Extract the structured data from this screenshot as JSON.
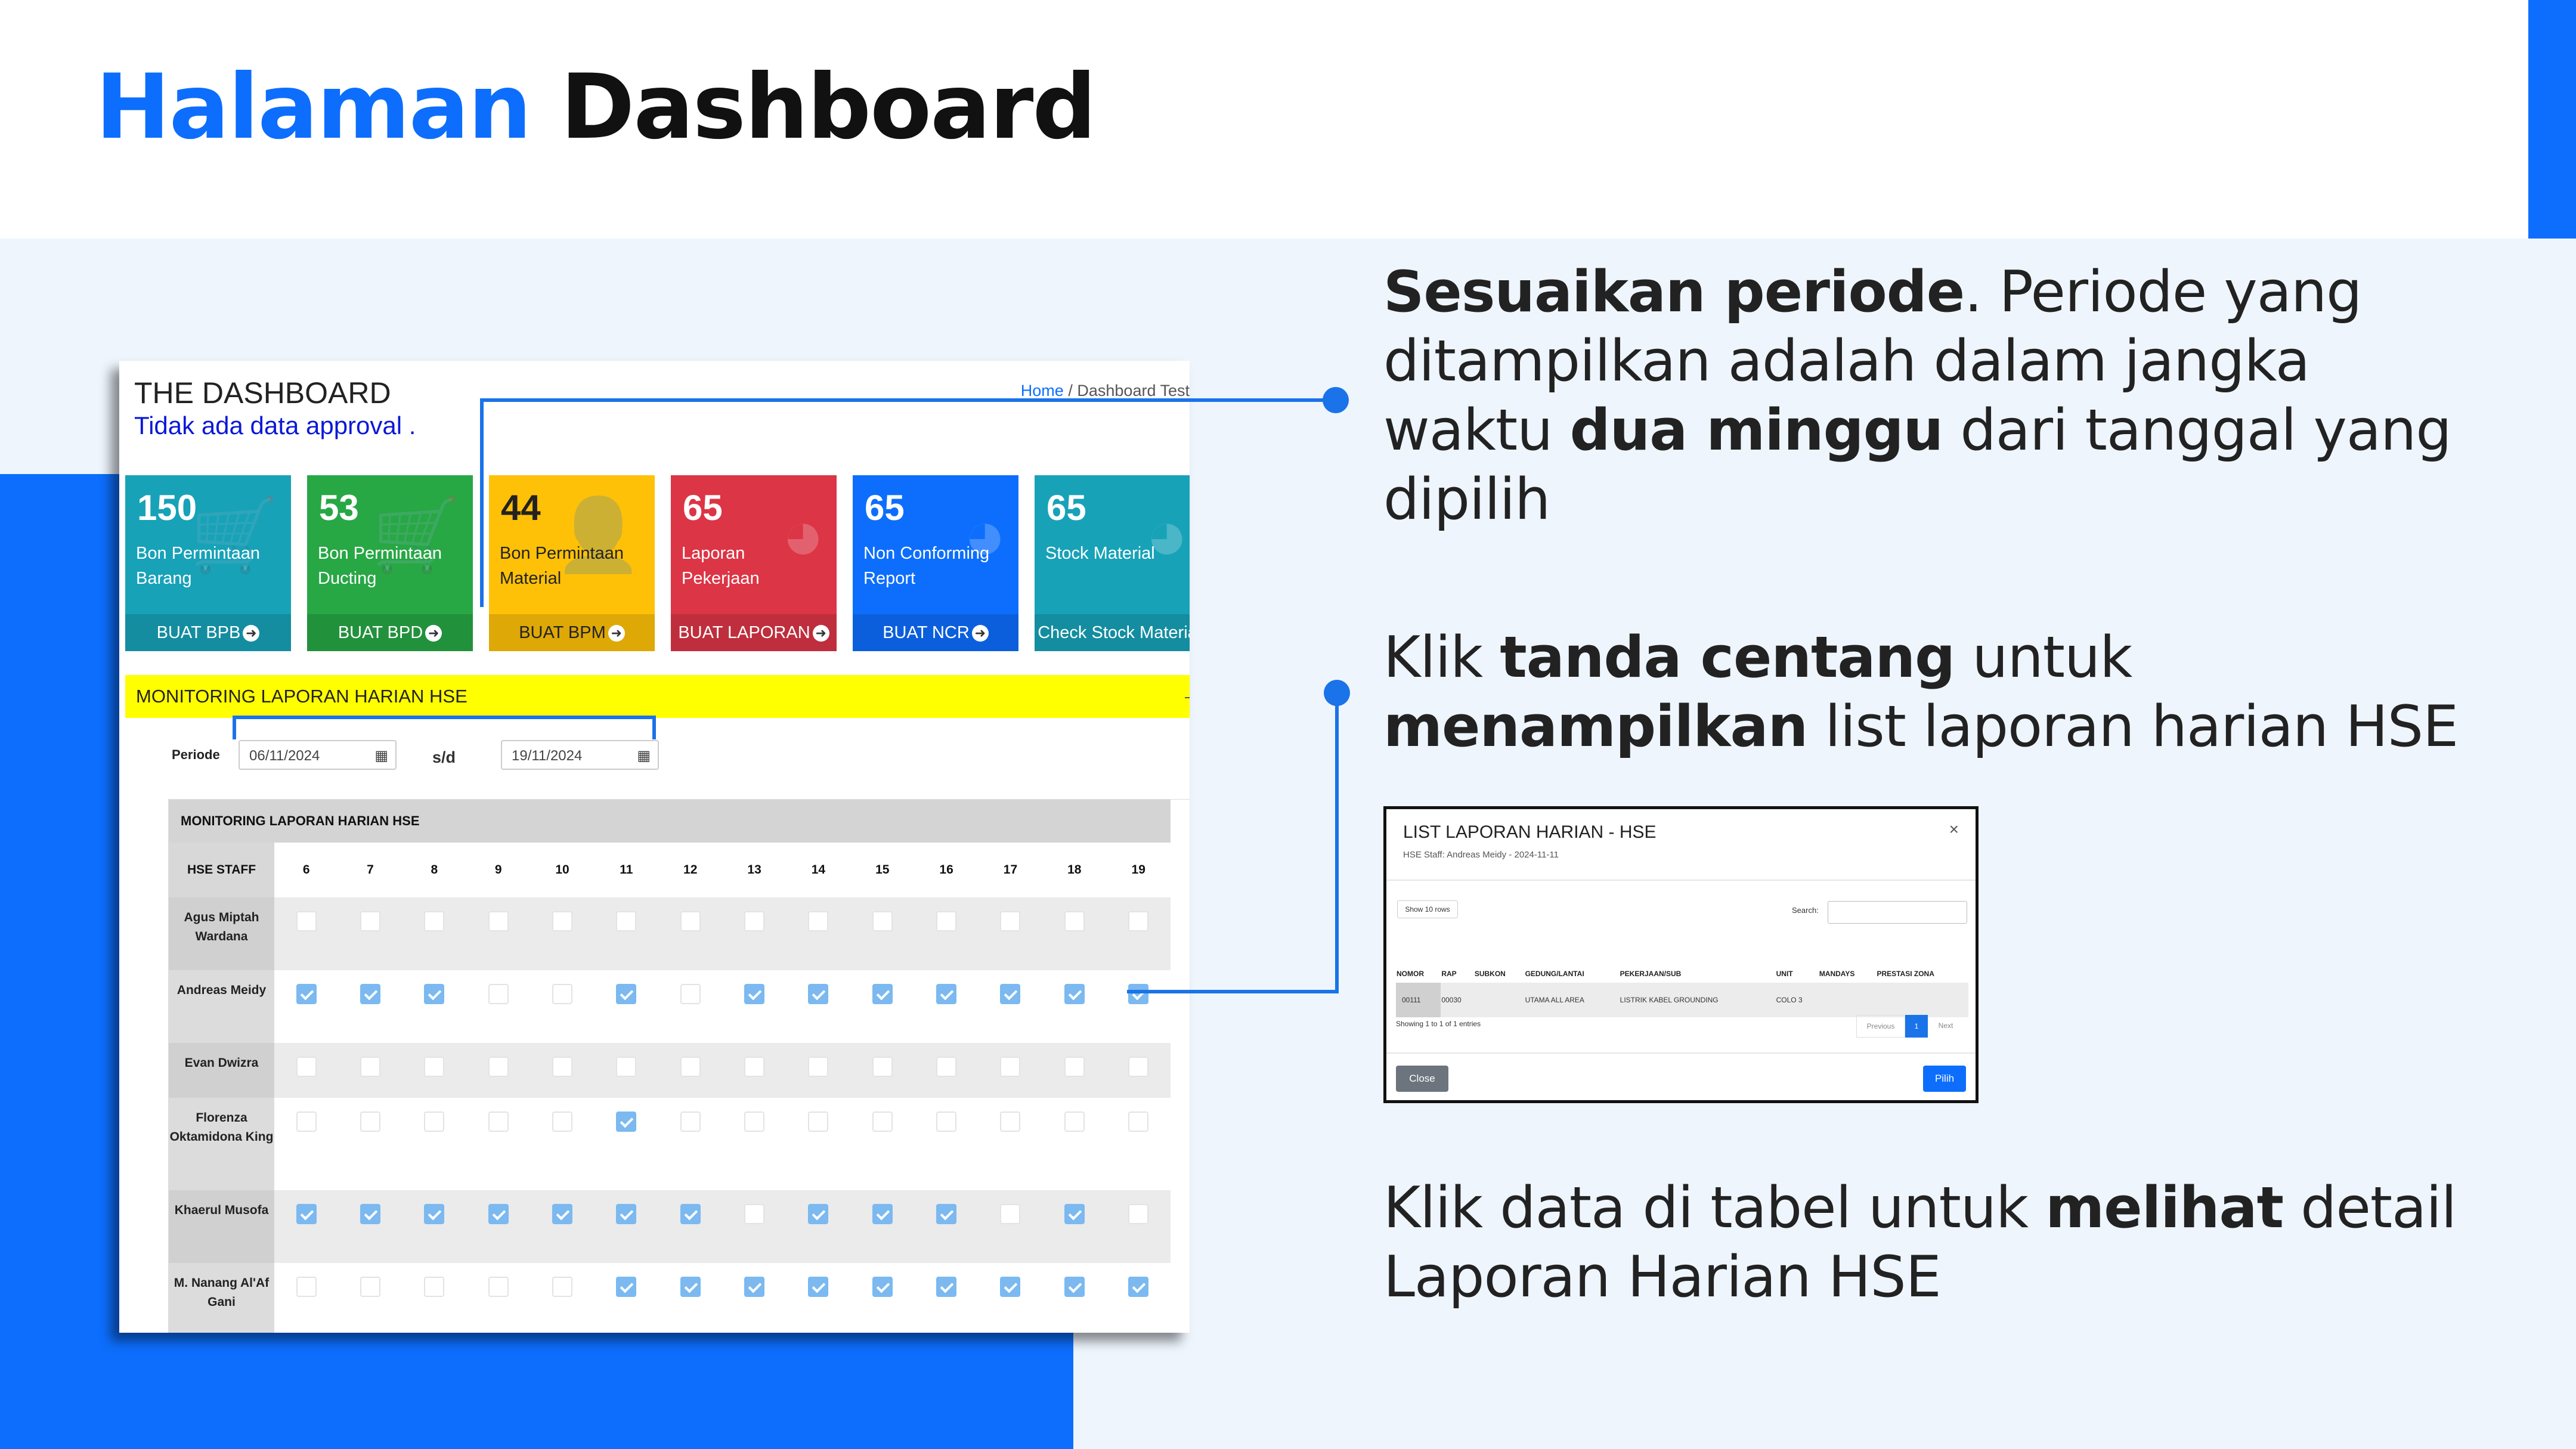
{
  "slide": {
    "title_accent": "Halaman",
    "title_rest": "Dashboard"
  },
  "dashboard": {
    "title": "THE DASHBOARD",
    "subtitle": "Tidak ada data approval .",
    "breadcrumb_home": "Home",
    "breadcrumb_sep": "/",
    "breadcrumb_current": "Dashboard Test",
    "cards": [
      {
        "count": "150",
        "label": "Bon Permintaan Barang",
        "action": "BUAT BPB",
        "color": "#17a2b8",
        "icon": "cart-icon"
      },
      {
        "count": "53",
        "label": "Bon Permintaan Ducting",
        "action": "BUAT BPD",
        "color": "#28a745",
        "icon": "cart-icon"
      },
      {
        "count": "44",
        "label": "Bon Permintaan Material",
        "action": "BUAT BPM",
        "color": "#ffc107",
        "icon": "user-plus-icon"
      },
      {
        "count": "65",
        "label": "Laporan Pekerjaan",
        "action": "BUAT LAPORAN",
        "color": "#dc3545",
        "icon": "pie-chart-icon"
      },
      {
        "count": "65",
        "label": "Non Conforming Report",
        "action": "BUAT NCR",
        "color": "#0d6efd",
        "icon": "pie-chart-icon"
      },
      {
        "count": "65",
        "label": "Stock Material",
        "action": "Check Stock Materia",
        "color": "#17a2b8",
        "icon": "pie-chart-icon"
      }
    ],
    "banner": "MONITORING LAPORAN HARIAN HSE",
    "banner_collapse": "—",
    "periode_label": "Periode",
    "date_from": "06/11/2024",
    "date_sep": "s/d",
    "date_to": "19/11/2024",
    "table_title": "MONITORING LAPORAN HARIAN HSE",
    "staff_header": "HSE STAFF",
    "days": [
      "6",
      "7",
      "8",
      "9",
      "10",
      "11",
      "12",
      "13",
      "14",
      "15",
      "16",
      "17",
      "18",
      "19"
    ],
    "rows": [
      {
        "name": "Agus Miptah Wardana",
        "checks": [
          0,
          0,
          0,
          0,
          0,
          0,
          0,
          0,
          0,
          0,
          0,
          0,
          0,
          0
        ]
      },
      {
        "name": "Andreas Meidy",
        "checks": [
          1,
          1,
          1,
          0,
          0,
          1,
          0,
          1,
          1,
          1,
          1,
          1,
          1,
          1
        ]
      },
      {
        "name": "Evan Dwizra",
        "checks": [
          0,
          0,
          0,
          0,
          0,
          0,
          0,
          0,
          0,
          0,
          0,
          0,
          0,
          0
        ]
      },
      {
        "name": "Florenza Oktamidona King",
        "checks": [
          0,
          0,
          0,
          0,
          0,
          1,
          0,
          0,
          0,
          0,
          0,
          0,
          0,
          0
        ]
      },
      {
        "name": "Khaerul Musofa",
        "checks": [
          1,
          1,
          1,
          1,
          1,
          1,
          1,
          0,
          1,
          1,
          1,
          0,
          1,
          0
        ]
      },
      {
        "name": "M. Nanang Al'Af Gani",
        "checks": [
          0,
          0,
          0,
          0,
          0,
          1,
          1,
          1,
          1,
          1,
          1,
          1,
          1,
          1
        ]
      }
    ]
  },
  "annotations": {
    "a1_bold": "Sesuaikan periode",
    "a1_text1": ". Periode yang ditampilkan adalah dalam jangka waktu ",
    "a1_bold2": "dua minggu",
    "a1_text2": " dari tanggal yang dipilih",
    "a2_text1": "Klik ",
    "a2_bold1": "tanda centang",
    "a2_text2": " untuk ",
    "a2_bold2": "menampilkan",
    "a2_text3": " list laporan harian HSE",
    "a3_text1": "Klik data di tabel untuk ",
    "a3_bold": "melihat",
    "a3_text2": " detail Laporan Harian HSE"
  },
  "modal": {
    "title": "LIST LAPORAN HARIAN - HSE",
    "subtitle": "HSE Staff: Andreas Meidy - 2024-11-11",
    "close_x": "×",
    "show_rows": "Show 10 rows",
    "search_label": "Search:",
    "columns": [
      "NOMOR",
      "RAP",
      "SUBKON",
      "GEDUNG/LANTAI",
      "PEKERJAAN/SUB",
      "UNIT",
      "MANDAYS",
      "PRESTASI ZONA"
    ],
    "row": {
      "nomor": "00111",
      "rap": "00030",
      "subkon": "",
      "gedung": "UTAMA ALL AREA",
      "pekerjaan": "LISTRIK KABEL GROUNDING",
      "unit": "COLO 3",
      "mandays": "",
      "prestasi": ""
    },
    "info": "Showing 1 to 1 of 1 entries",
    "prev": "Previous",
    "page": "1",
    "next": "Next",
    "btn_close": "Close",
    "btn_pilih": "Pilih"
  }
}
